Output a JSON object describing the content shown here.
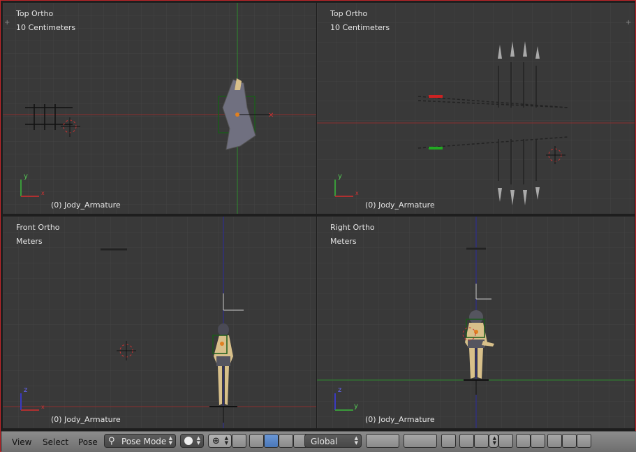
{
  "viewports": [
    {
      "id": "top-left",
      "title": "Top Ortho",
      "scale": "10 Centimeters",
      "object": "(0) Jody_Armature",
      "axis_a": "y",
      "axis_b": "x"
    },
    {
      "id": "top-right",
      "title": "Top Ortho",
      "scale": "10 Centimeters",
      "object": "(0) Jody_Armature",
      "axis_a": "y",
      "axis_b": "x"
    },
    {
      "id": "bottom-left",
      "title": "Front Ortho",
      "scale": "Meters",
      "object": "(0) Jody_Armature",
      "axis_a": "z",
      "axis_b": "x"
    },
    {
      "id": "bottom-right",
      "title": "Right Ortho",
      "scale": "Meters",
      "object": "(0) Jody_Armature",
      "axis_a": "z",
      "axis_b": "y"
    }
  ],
  "toolbar": {
    "menu_view": "View",
    "menu_select": "Select",
    "menu_pose": "Pose",
    "mode": "Pose Mode",
    "orientation": "Global"
  },
  "colors": {
    "x_axis": "#9a2a2a",
    "y_axis": "#2d8a2d",
    "z_axis": "#2a2aa0",
    "viewport_bg": "#393939",
    "frame_border": "#c0262a"
  }
}
